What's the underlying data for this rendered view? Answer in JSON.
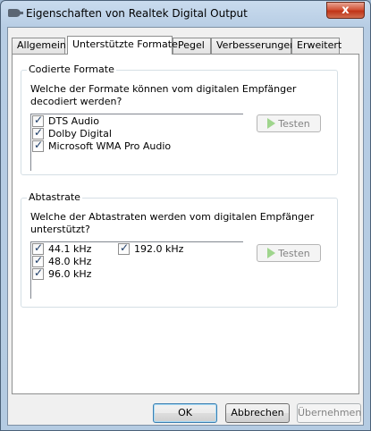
{
  "window": {
    "title": "Eigenschaften von Realtek Digital Output",
    "close_glyph": "x"
  },
  "tabs": [
    {
      "label": "Allgemein",
      "active": false
    },
    {
      "label": "Unterstützte Formate",
      "active": true
    },
    {
      "label": "Pegel",
      "active": false
    },
    {
      "label": "Verbesserungen",
      "active": false
    },
    {
      "label": "Erweitert",
      "active": false
    }
  ],
  "encoded_formats": {
    "title": "Codierte Formate",
    "question": "Welche der Formate können vom digitalen Empfänger decodiert werden?",
    "items": [
      {
        "label": "DTS Audio",
        "checked": true
      },
      {
        "label": "Dolby Digital",
        "checked": true
      },
      {
        "label": "Microsoft WMA Pro Audio",
        "checked": true
      }
    ],
    "test_label": "Testen"
  },
  "sample_rates": {
    "title": "Abtastrate",
    "question": "Welche der Abtastraten werden vom digitalen Empfänger unterstützt?",
    "items": [
      {
        "label": "44.1 kHz",
        "checked": true
      },
      {
        "label": "48.0 kHz",
        "checked": true
      },
      {
        "label": "96.0 kHz",
        "checked": true
      },
      {
        "label": "192.0 kHz",
        "checked": true
      }
    ],
    "test_label": "Testen"
  },
  "buttons": {
    "ok": "OK",
    "cancel": "Abbrechen",
    "apply": "Übernehmen"
  },
  "colors": {
    "title_bar": "#c9dbee",
    "close_button": "#c03418",
    "play_icon": "#9fd58d",
    "checkmark": "#1c3c68"
  }
}
